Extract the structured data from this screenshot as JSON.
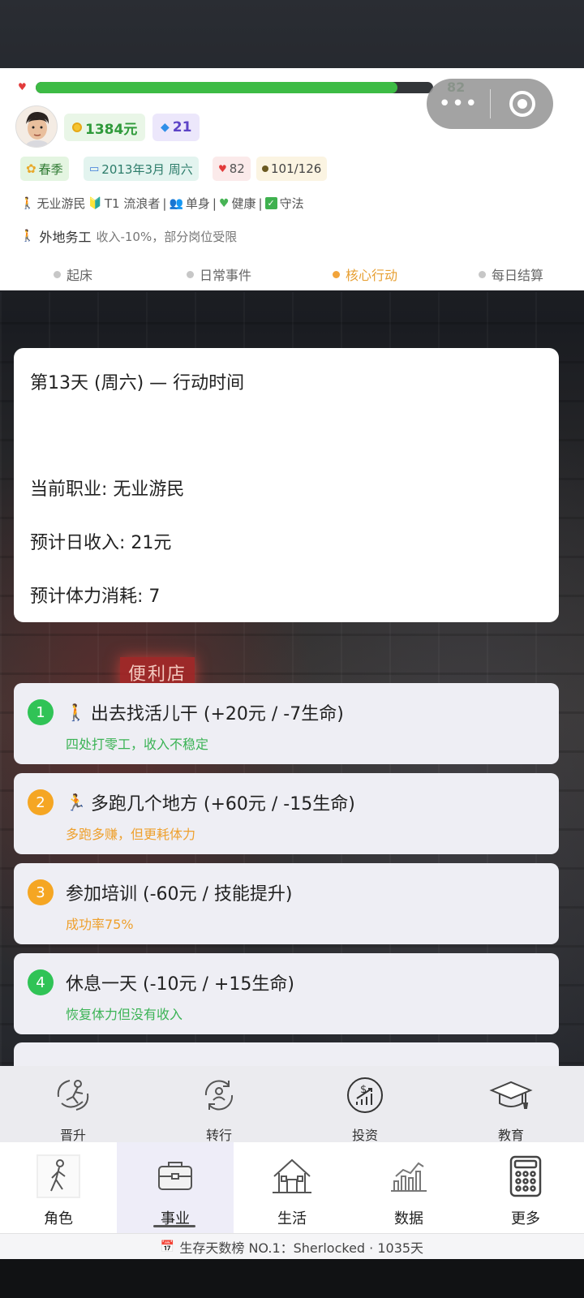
{
  "player": {
    "hp_value": "82",
    "hp_fraction": 0.91,
    "money": "1384元",
    "gems": "21"
  },
  "chips": {
    "season": "春季",
    "date": "2013年3月 周六",
    "health": "82",
    "energy": "101/126"
  },
  "status": {
    "occupation": "无业游民",
    "tier": "T1 流浪者",
    "relationship": "单身",
    "health": "健康",
    "law": "守法",
    "sep": "|"
  },
  "work": {
    "title": "外地务工",
    "desc": "收入-10%，部分岗位受限"
  },
  "phases": [
    {
      "label": "起床",
      "active": false
    },
    {
      "label": "日常事件",
      "active": false
    },
    {
      "label": "核心行动",
      "active": true
    },
    {
      "label": "每日结算",
      "active": false
    }
  ],
  "info": {
    "title": "第13天 (周六) — 行动时间",
    "job": "当前职业: 无业游民",
    "income": "预计日收入: 21元",
    "stamina": "预计体力消耗: 7"
  },
  "background_sign": "便利店",
  "options": [
    {
      "num": "1",
      "title": "出去找活儿干 (+20元 / -7生命)",
      "sub": "四处打零工，收入不稳定",
      "color": "green",
      "icon": "walking-person-icon"
    },
    {
      "num": "2",
      "title": "多跑几个地方 (+60元 / -15生命)",
      "sub": "多跑多赚，但更耗体力",
      "color": "orange",
      "icon": "running-person-icon"
    },
    {
      "num": "3",
      "title": "参加培训 (-60元 / 技能提升)",
      "sub": "成功率75%",
      "color": "orange",
      "icon": ""
    },
    {
      "num": "4",
      "title": "休息一天 (-10元 / +15生命)",
      "sub": "恢复体力但没有收入",
      "color": "green",
      "icon": ""
    }
  ],
  "sub_tabs": [
    {
      "label": "晋升",
      "icon": "promotion-icon"
    },
    {
      "label": "转行",
      "icon": "career-change-icon"
    },
    {
      "label": "投资",
      "icon": "investment-icon"
    },
    {
      "label": "教育",
      "icon": "graduation-cap-icon"
    }
  ],
  "nav": [
    {
      "label": "角色",
      "icon": "character-icon",
      "active": false
    },
    {
      "label": "事业",
      "icon": "briefcase-icon",
      "active": true
    },
    {
      "label": "生活",
      "icon": "house-icon",
      "active": false
    },
    {
      "label": "数据",
      "icon": "bar-chart-icon",
      "active": false
    },
    {
      "label": "更多",
      "icon": "calculator-icon",
      "active": false
    }
  ],
  "rank_text": "生存天数榜 NO.1：Sherlocked · 1035天",
  "colors": {
    "accent_green": "#3dbb45",
    "accent_orange": "#f5a623",
    "active_phase": "#e7a034"
  }
}
